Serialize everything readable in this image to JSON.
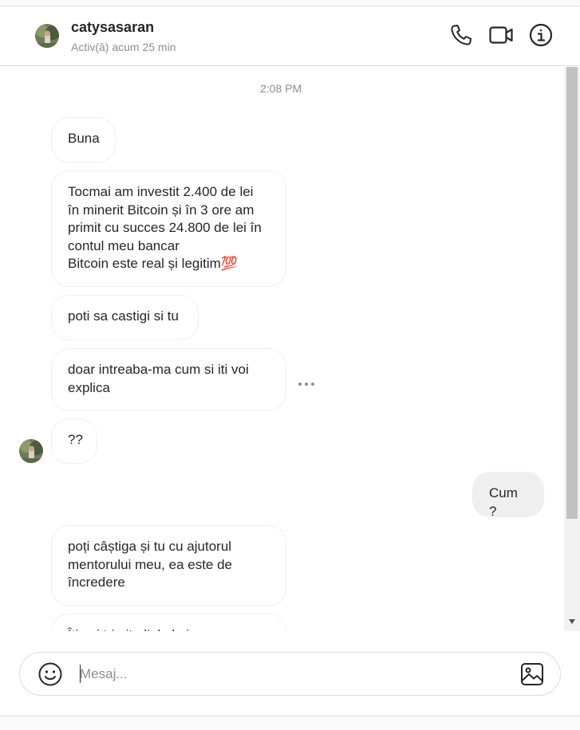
{
  "header": {
    "username": "catysasaran",
    "status": "Activ(ă) acum 25 min",
    "avatar_icon": "profile-photo-avatar",
    "actions": [
      {
        "name": "phone-call-icon"
      },
      {
        "name": "video-call-icon"
      },
      {
        "name": "info-icon"
      }
    ]
  },
  "thread": {
    "timestamp": "2:08 PM",
    "messages": [
      {
        "from": "them",
        "text": "Buna"
      },
      {
        "from": "them",
        "text": "Tocmai am investit 2.400 de lei\nîn minerit Bitcoin și în 3 ore am\nprimit cu succes 24.800 de lei în\ncontul meu bancar\nBitcoin este real și legitim💯"
      },
      {
        "from": "them",
        "text": "poti sa castigi si tu"
      },
      {
        "from": "them",
        "text": "doar intreaba-ma cum si iti voi\nexplica"
      },
      {
        "from": "them",
        "text": "??"
      },
      {
        "from": "me",
        "text": "Cum ?"
      },
      {
        "from": "them",
        "text": "poți câștiga și tu cu ajutorul\nmentorului meu, ea este de\nîncredere"
      },
      {
        "from": "them",
        "text": "Îți voi trimite linkul ei"
      }
    ],
    "more_options_icon": "more-horizontal-icon"
  },
  "composer": {
    "placeholder": "Mesaj...",
    "value": "",
    "emoji_icon": "emoji-icon",
    "image_icon": "image-upload-icon"
  },
  "colors": {
    "text": "#262626",
    "secondary_text": "#8e8e8e",
    "border": "#dbdbdb",
    "my_bubble": "#efefef"
  }
}
